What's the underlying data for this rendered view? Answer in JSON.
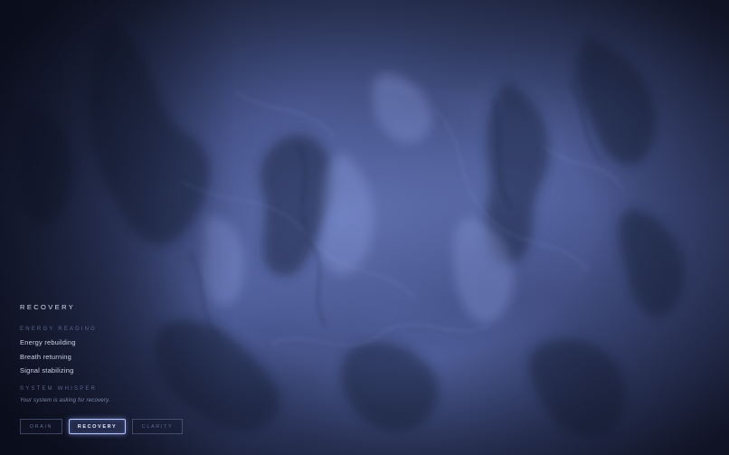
{
  "panel": {
    "state_title": "RECOVERY",
    "energy_label": "ENERGY READING",
    "readings": [
      "Energy rebuilding",
      "Breath returning",
      "Signal stabilizing"
    ],
    "whisper_label": "SYSTEM WHISPER",
    "whisper_text": "Your system is asking for recovery."
  },
  "modes": {
    "items": [
      "DRAIN",
      "RECOVERY",
      "CLARITY"
    ],
    "selected": "RECOVERY"
  },
  "colors": {
    "background": "#3f4b80",
    "accent": "#b8c6ff",
    "text": "#cbd2e8",
    "muted_label": "#59648a"
  }
}
